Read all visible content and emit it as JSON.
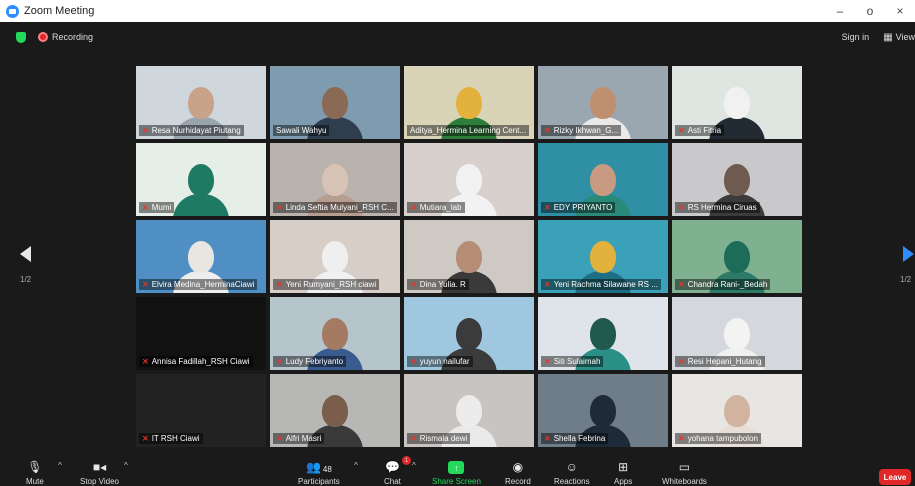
{
  "window": {
    "title": "Zoom Meeting",
    "minimize": "–",
    "restore": "o",
    "close": "×"
  },
  "topbar": {
    "recording_label": "Recording",
    "signin_label": "Sign in",
    "view_label": "View"
  },
  "pagination": {
    "left": "1/2",
    "right": "1/2"
  },
  "toolbar": {
    "mute": "Mute",
    "stop_video": "Stop Video",
    "participants": "Participants",
    "participants_count": "48",
    "chat": "Chat",
    "chat_badge": "1",
    "share_screen": "Share Screen",
    "record": "Record",
    "reactions": "Reactions",
    "apps": "Apps",
    "whiteboards": "Whiteboards",
    "leave": "Leave"
  },
  "participants": [
    {
      "name": "Resa Nurhidayat Piutang",
      "muted": true
    },
    {
      "name": "Sawali Wahyu",
      "muted": false
    },
    {
      "name": "Aditya_Hermina Learning Cent...",
      "muted": false
    },
    {
      "name": "Rizky Ikhwan_G...",
      "muted": true
    },
    {
      "name": "Asti Fitria",
      "muted": true
    },
    {
      "name": "Mumi",
      "muted": true
    },
    {
      "name": "Linda Seftia Mulyani_RSH C...",
      "muted": true
    },
    {
      "name": "Mutiara_lab",
      "muted": true
    },
    {
      "name": "EDY PRIYANTO",
      "muted": true
    },
    {
      "name": "RS Hermina Ciruas",
      "muted": true
    },
    {
      "name": "Elvira Medina_HerminaCiawi",
      "muted": true
    },
    {
      "name": "Yeni Rumyani_RSH ciawi",
      "muted": true
    },
    {
      "name": "Dina Yulia. R",
      "muted": true
    },
    {
      "name": "Yeni Rachma Silawane RS ...",
      "muted": true
    },
    {
      "name": "Chandra Rani-_Bedah",
      "muted": true
    },
    {
      "name": "Annisa Fadillah_RSH Ciawi",
      "muted": true
    },
    {
      "name": "Ludy Febriyanto",
      "muted": true
    },
    {
      "name": "yuyun nailufar",
      "muted": true
    },
    {
      "name": "Siti Sulaimah",
      "muted": true
    },
    {
      "name": "Resi Hepani_Hutang",
      "muted": true
    },
    {
      "name": "IT RSH Ciawi",
      "muted": true
    },
    {
      "name": "Alfri Masri",
      "muted": true
    },
    {
      "name": "Rismala dewi",
      "muted": true
    },
    {
      "name": "Shella Febrina",
      "muted": true
    },
    {
      "name": "yohana tampubolon",
      "muted": true
    }
  ],
  "colors": {
    "accent": "#2d8cff",
    "recording": "#e02828",
    "share": "#23d959",
    "active_speaker": "#a3d24a"
  }
}
